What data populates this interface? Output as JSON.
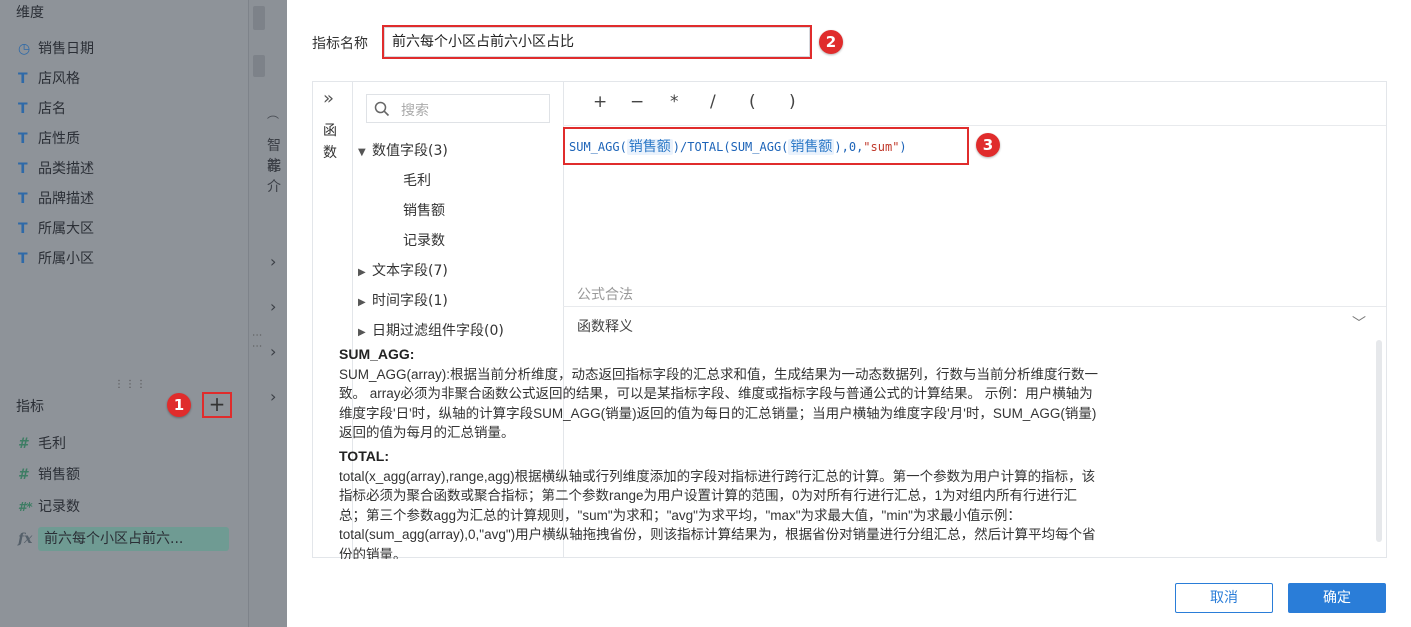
{
  "left_panel": {
    "dimensions_header": "维度",
    "dimensions": [
      {
        "icon": "calendar-icon",
        "glyph": "◷",
        "label": "销售日期"
      },
      {
        "icon": "text-field-icon",
        "glyph": "T",
        "label": "店风格"
      },
      {
        "icon": "text-field-icon",
        "glyph": "T",
        "label": "店名"
      },
      {
        "icon": "text-field-icon",
        "glyph": "T",
        "label": "店性质"
      },
      {
        "icon": "text-field-icon",
        "glyph": "T",
        "label": "品类描述"
      },
      {
        "icon": "text-field-icon",
        "glyph": "T",
        "label": "品牌描述"
      },
      {
        "icon": "text-field-icon",
        "glyph": "T",
        "label": "所属大区"
      },
      {
        "icon": "text-field-icon",
        "glyph": "T",
        "label": "所属小区"
      }
    ],
    "metrics_header": "指标",
    "add_glyph": "+",
    "metrics": [
      {
        "icon": "number-field-icon",
        "glyph": "#",
        "label": "毛利"
      },
      {
        "icon": "number-field-icon",
        "glyph": "#",
        "label": "销售额"
      },
      {
        "icon": "count-field-icon",
        "glyph": "#*",
        "label": "记录数"
      },
      {
        "icon": "formula-field-icon",
        "glyph": "fx",
        "label": "前六每个小区占前六..."
      }
    ],
    "partial_text": [
      "智能",
      "荐介"
    ]
  },
  "badges": [
    "1",
    "2",
    "3"
  ],
  "dialog": {
    "name_label": "指标名称",
    "name_value": "前六每个小区占前六小区占比",
    "fn_collapse_glyph": "»",
    "fn_tab_chars": [
      "函",
      "数"
    ],
    "search_placeholder": "搜索",
    "tree": [
      {
        "label": "数值字段(3)",
        "expanded": true,
        "children": [
          "毛利",
          "销售额",
          "记录数"
        ]
      },
      {
        "label": "文本字段(7)",
        "expanded": false
      },
      {
        "label": "时间字段(1)",
        "expanded": false
      },
      {
        "label": "日期过滤组件字段(0)",
        "expanded": false
      }
    ],
    "operators": [
      "+",
      "−",
      "*",
      "/",
      "(",
      ")"
    ],
    "formula": {
      "p1": "SUM_AGG(",
      "f1": "销售额",
      "p2": ")/TOTAL(SUM_AGG(",
      "f2": "销售额",
      "p3": "),0,",
      "s1": "\"sum\"",
      "p4": ")"
    },
    "validity": "公式合法",
    "desc_title": "函数释义",
    "desc": [
      {
        "title": "SUM_AGG:",
        "text": "SUM_AGG(array):根据当前分析维度，动态返回指标字段的汇总求和值，生成结果为一动态数据列，行数与当前分析维度行数一致。 array必须为非聚合函数公式返回的结果，可以是某指标字段、维度或指标字段与普通公式的计算结果。 示例：用户横轴为维度字段'日'时，纵轴的计算字段SUM_AGG(销量)返回的值为每日的汇总销量；当用户横轴为维度字段'月'时，SUM_AGG(销量)返回的值为每月的汇总销量。"
      },
      {
        "title": "TOTAL:",
        "text": "total(x_agg(array),range,agg)根据横纵轴或行列维度添加的字段对指标进行跨行汇总的计算。第一个参数为用户计算的指标，该指标必须为聚合函数或聚合指标；第二个参数range为用户设置计算的范围，0为对所有行进行汇总，1为对组内所有行进行汇总；第三个参数agg为汇总的计算规则，\"sum\"为求和；\"avg\"为求平均，\"max\"为求最大值，\"min\"为求最小值示例：total(sum_agg(array),0,\"avg\")用户横纵轴拖拽省份，则该指标计算结果为，根据省份对销量进行分组汇总，然后计算平均每个省份的销量。"
      }
    ],
    "cancel_label": "取消",
    "ok_label": "确定"
  }
}
